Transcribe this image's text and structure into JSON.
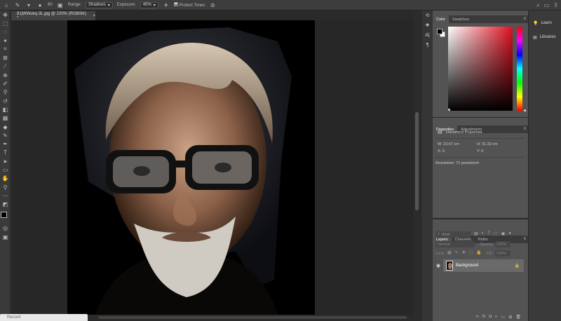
{
  "options": {
    "brush_size": "60",
    "range_label": "Range:",
    "range_value": "Shadows",
    "exposure_label": "Exposure:",
    "exposure_value": "45%",
    "protect_tones_label": "Protect Tones"
  },
  "document": {
    "tab_title": "81jWWukq-3L.jpg @ 220% (RGB/8#) *",
    "close_glyph": "×"
  },
  "statusbar": {
    "record_label": "Record"
  },
  "color_panel": {
    "tabs": [
      "Color",
      "Swatches"
    ]
  },
  "properties_panel": {
    "tabs": [
      "Properties",
      "Adjustments"
    ],
    "section": "Document Properties",
    "w": "W: 23.67 cm",
    "h": "H: 31.33 cm",
    "x": "X: 0",
    "y": "Y: 0",
    "resolution": "Resolution: 72 pixels/inch"
  },
  "layers_panel": {
    "tabs": [
      "Layers",
      "Channels",
      "Paths"
    ],
    "kind": "Kind",
    "blend": "Normal",
    "opacity_label": "Opacity:",
    "opacity_value": "100%",
    "lock_label": "Lock:",
    "fill_label": "Fill:",
    "fill_value": "100%",
    "layer_name": "Background"
  },
  "right_bar": {
    "learn": "Learn",
    "libraries": "Libraries"
  },
  "colors": {
    "accent": "#e01020"
  }
}
